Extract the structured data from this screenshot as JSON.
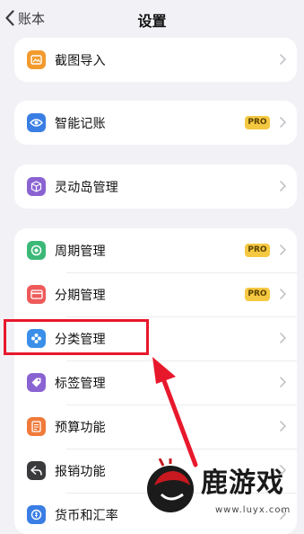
{
  "nav": {
    "back_label": "账本",
    "title": "设置"
  },
  "cards": [
    {
      "rows": [
        {
          "id": "screenshot-import",
          "label": "截图导入",
          "icon": "screenshot-import-icon",
          "color": "#f29a2e",
          "pro": false
        }
      ]
    },
    {
      "rows": [
        {
          "id": "smart-booking",
          "label": "智能记账",
          "icon": "eye-icon",
          "color": "#3a7ee4",
          "pro": true
        }
      ]
    },
    {
      "rows": [
        {
          "id": "dynamic-island",
          "label": "灵动岛管理",
          "icon": "cube-icon",
          "color": "#8a63d2",
          "pro": false
        }
      ]
    },
    {
      "rows": [
        {
          "id": "cycle",
          "label": "周期管理",
          "icon": "cycle-icon",
          "color": "#3cb878",
          "pro": true
        },
        {
          "id": "installment",
          "label": "分期管理",
          "icon": "card-icon",
          "color": "#ee5a5a",
          "pro": true
        },
        {
          "id": "category",
          "label": "分类管理",
          "icon": "category-icon",
          "color": "#3a8fe8",
          "pro": false
        },
        {
          "id": "tag",
          "label": "标签管理",
          "icon": "tag-icon",
          "color": "#8a63d2",
          "pro": false
        },
        {
          "id": "budget",
          "label": "预算功能",
          "icon": "budget-icon",
          "color": "#f07a3a",
          "pro": false
        },
        {
          "id": "reimburse",
          "label": "报销功能",
          "icon": "reimburse-icon",
          "color": "#3a3a3c",
          "pro": false
        },
        {
          "id": "currency",
          "label": "货币和汇率",
          "icon": "currency-icon",
          "color": "#3a7ee4",
          "pro": false
        }
      ]
    }
  ],
  "pro_label": "PRO",
  "watermark": {
    "text": "鹿游戏",
    "url": "www.luyx.com"
  },
  "colors": {
    "background": "#f2f2f6",
    "highlight": "#e8182c",
    "pro_badge": "#f5c842"
  }
}
